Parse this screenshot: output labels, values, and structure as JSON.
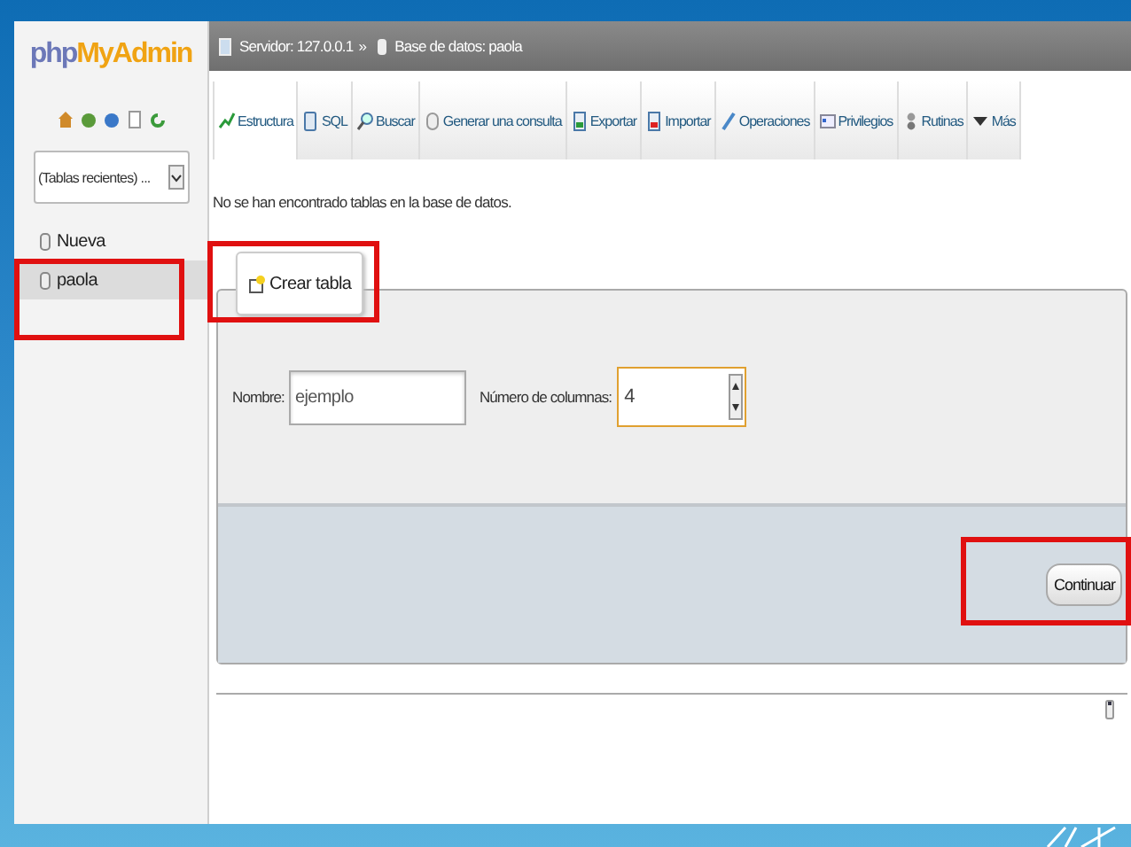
{
  "breadcrumb": {
    "server": "Servidor: 127.0.0.1",
    "separator": "»",
    "database": "Base de datos: paola"
  },
  "sidebar": {
    "logo": {
      "php": "php",
      "myadmin": "MyAdmin"
    },
    "recent_tables": "(Tablas recientes) ...",
    "tree": [
      {
        "label": "Nueva",
        "selected": false
      },
      {
        "label": "paola",
        "selected": true
      }
    ]
  },
  "tabs": [
    {
      "label": "Estructura",
      "selected": true
    },
    {
      "label": "SQL",
      "selected": false
    },
    {
      "label": "Buscar",
      "selected": false
    },
    {
      "label": "Generar una consulta",
      "selected": false
    },
    {
      "label": "Exportar",
      "selected": false
    },
    {
      "label": "Importar",
      "selected": false
    },
    {
      "label": "Operaciones",
      "selected": false
    },
    {
      "label": "Privilegios",
      "selected": false
    },
    {
      "label": "Rutinas",
      "selected": false
    },
    {
      "label": "Más",
      "selected": false
    }
  ],
  "message": "No se han encontrado tablas en la base de datos.",
  "create_table": {
    "legend": "Crear tabla",
    "name_label": "Nombre:",
    "name_value": "ejemplo",
    "columns_label": "Número de columnas:",
    "columns_value": "4",
    "submit": "Continuar"
  }
}
